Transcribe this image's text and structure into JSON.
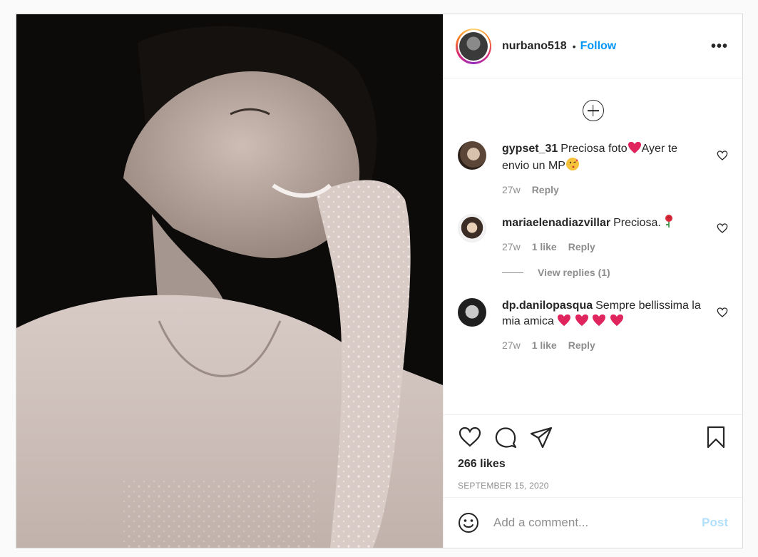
{
  "post": {
    "username": "nurbano518",
    "separator": "•",
    "follow_label": "Follow",
    "more_label": "•••"
  },
  "comments": [
    {
      "username": "gypset_31",
      "text_a": "Preciosa foto",
      "emoji_a": "heart-icon",
      "text_b": "Ayer te envio un MP",
      "emoji_b": "kissing-face-icon",
      "time": "27w",
      "reply_label": "Reply"
    },
    {
      "username": "mariaelenadiazvillar",
      "text_a": "Preciosa.",
      "emoji_a": "rose-icon",
      "time": "27w",
      "likes": "1 like",
      "reply_label": "Reply",
      "view_replies": "View replies (1)"
    },
    {
      "username": "dp.danilopasqua",
      "text_a": "Sempre bellissima la mia amica",
      "emoji_a": "heart-icon",
      "time": "27w",
      "likes": "1 like",
      "reply_label": "Reply"
    }
  ],
  "actions": {
    "likes": "266 likes",
    "date": "SEPTEMBER 15, 2020"
  },
  "add_comment": {
    "placeholder": "Add a comment...",
    "post_label": "Post"
  },
  "colors": {
    "follow": "#0095f6",
    "post_disabled": "#b2dffc",
    "muted": "#8e8e8e"
  }
}
